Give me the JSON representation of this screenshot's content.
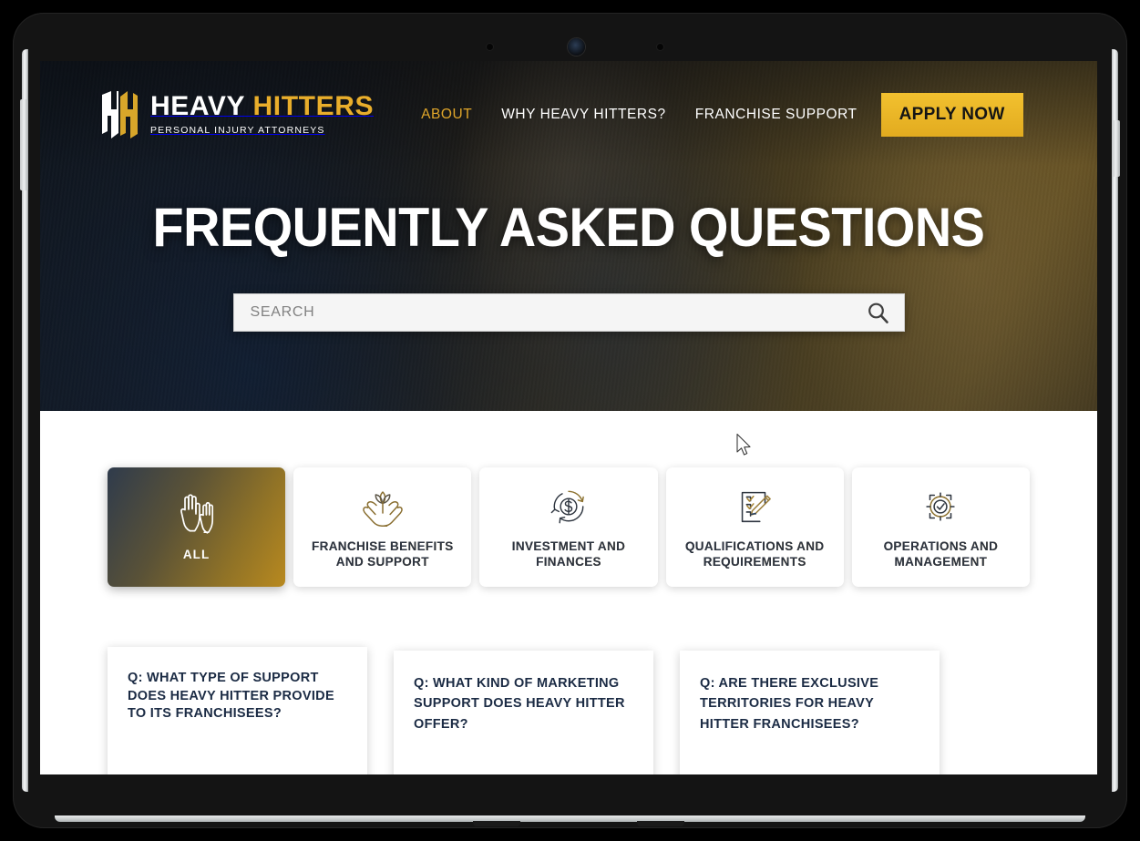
{
  "site": {
    "brand": {
      "mark": "hh-monogram-logo",
      "word_one": "HEAVY",
      "word_two": "HITTERS",
      "tagline": "PERSONAL INJURY ATTORNEYS"
    },
    "nav": [
      {
        "label": "ABOUT",
        "active": true
      },
      {
        "label": "WHY HEAVY HITTERS?",
        "active": false
      },
      {
        "label": "FRANCHISE SUPPORT",
        "active": false
      }
    ],
    "cta": {
      "label": "APPLY NOW"
    }
  },
  "hero": {
    "title": "FREQUENTLY ASKED QUESTIONS",
    "search": {
      "placeholder": "SEARCH",
      "value": "",
      "icon": "search-icon"
    }
  },
  "categories": [
    {
      "id": "all",
      "label": "ALL",
      "icon": "raised-hands-icon",
      "active": true
    },
    {
      "id": "franchise-benefits-and-support",
      "label": "FRANCHISE BENEFITS AND SUPPORT",
      "icon": "hands-holding-plant-icon",
      "active": false
    },
    {
      "id": "investment-and-finances",
      "label": "INVESTMENT AND FINANCES",
      "icon": "dollar-cycle-icon",
      "active": false
    },
    {
      "id": "qualifications-and-requirements",
      "label": "QUALIFICATIONS AND REQUIREMENTS",
      "icon": "checklist-pen-icon",
      "active": false
    },
    {
      "id": "operations-and-management",
      "label": "OPERATIONS AND MANAGEMENT",
      "icon": "target-checkmark-icon",
      "active": false
    }
  ],
  "faqs": [
    {
      "question": "Q: WHAT TYPE OF SUPPORT DOES HEAVY HITTER PROVIDE TO ITS FRANCHISEES?"
    },
    {
      "question": "Q: WHAT KIND OF MARKETING SUPPORT DOES HEAVY HITTER OFFER?"
    },
    {
      "question": "Q: ARE THERE EXCLUSIVE TERRITORIES FOR HEAVY HITTER FRANCHISEES?"
    }
  ],
  "device": {
    "type": "tablet-mockup",
    "camera": "front-camera"
  },
  "colors": {
    "gold": "#e9ae2b",
    "cta_gold": "#f2c12f",
    "navy_text": "#1b2b44",
    "hero_dark": "#16202c"
  }
}
